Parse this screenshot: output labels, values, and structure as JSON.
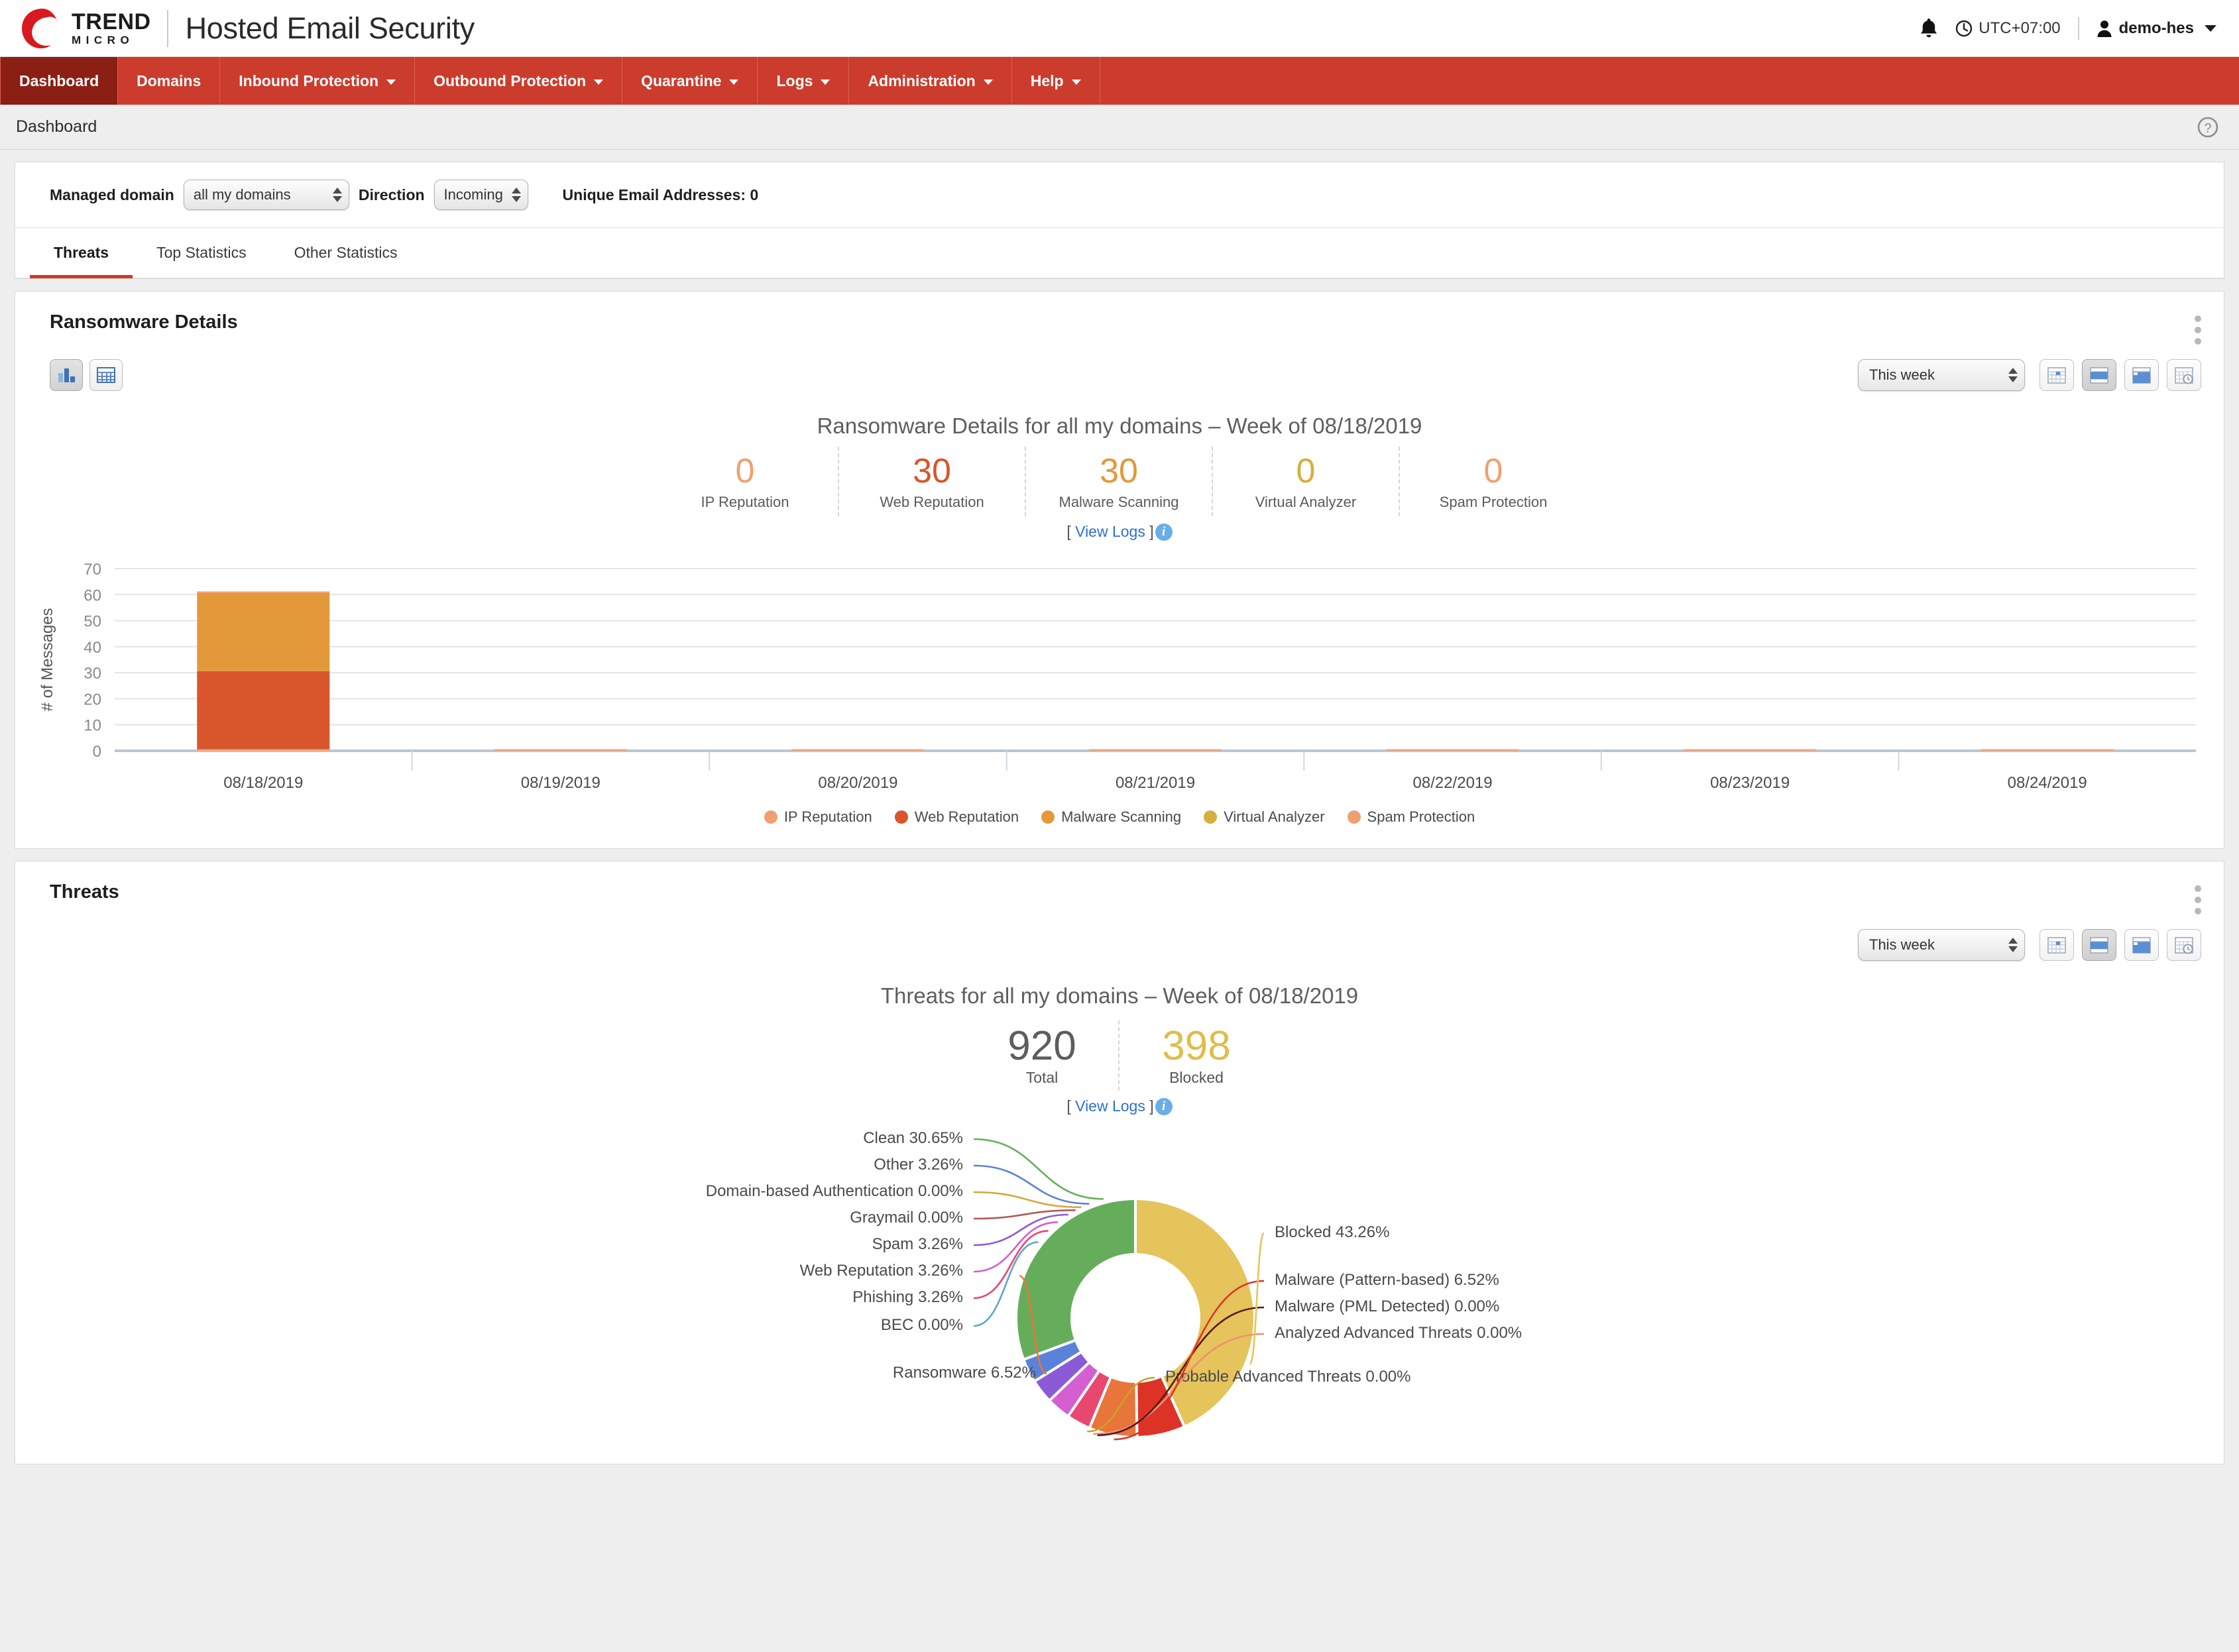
{
  "header": {
    "brand_line1": "TREND",
    "brand_line2": "MICRO",
    "app_title": "Hosted Email Security",
    "timezone": "UTC+07:00",
    "user": "demo-hes"
  },
  "nav": [
    {
      "label": "Dashboard",
      "has_caret": false,
      "active": true
    },
    {
      "label": "Domains",
      "has_caret": false,
      "active": false
    },
    {
      "label": "Inbound Protection",
      "has_caret": true,
      "active": false
    },
    {
      "label": "Outbound Protection",
      "has_caret": true,
      "active": false
    },
    {
      "label": "Quarantine",
      "has_caret": true,
      "active": false
    },
    {
      "label": "Logs",
      "has_caret": true,
      "active": false
    },
    {
      "label": "Administration",
      "has_caret": true,
      "active": false
    },
    {
      "label": "Help",
      "has_caret": true,
      "active": false
    }
  ],
  "breadcrumb": {
    "label": "Dashboard"
  },
  "filters": {
    "managed_domain_label": "Managed domain",
    "managed_domain_value": "all my domains",
    "direction_label": "Direction",
    "direction_value": "Incoming",
    "unique_emails": "Unique Email Addresses: 0"
  },
  "tabs": [
    {
      "label": "Threats",
      "active": true
    },
    {
      "label": "Top Statistics",
      "active": false
    },
    {
      "label": "Other Statistics",
      "active": false
    }
  ],
  "ransomware_panel": {
    "title": "Ransomware Details",
    "period_value": "This week",
    "view_chart_icon": "bar-chart-icon",
    "view_table_icon": "table-icon",
    "range_icons": [
      "calendar-day-icon",
      "calendar-week-icon",
      "calendar-month-icon",
      "calendar-history-icon"
    ],
    "view_logs_text": "[ View Logs ]",
    "view_logs_link": "View Logs"
  },
  "threats_panel": {
    "title": "Threats",
    "period_value": "This week",
    "view_logs_text": "[ View Logs ]",
    "view_logs_link": "View Logs",
    "total_label": "Total",
    "total_value": "920",
    "blocked_label": "Blocked",
    "blocked_value": "398"
  },
  "chart_data": [
    {
      "type": "bar",
      "title": "Ransomware Details for all my domains – Week of 08/18/2019",
      "xlabel": "",
      "ylabel": "# of Messages",
      "ylim": [
        0,
        70
      ],
      "yticks": [
        0,
        10,
        20,
        30,
        40,
        50,
        60,
        70
      ],
      "grid": true,
      "legend_position": "bottom",
      "stacked": true,
      "categories": [
        "08/18/2019",
        "08/19/2019",
        "08/20/2019",
        "08/21/2019",
        "08/22/2019",
        "08/23/2019",
        "08/24/2019"
      ],
      "series": [
        {
          "name": "IP Reputation",
          "color": "#f0a070",
          "values": [
            0.6,
            0.6,
            0.6,
            0.6,
            0.6,
            0.6,
            0.6
          ]
        },
        {
          "name": "Web Reputation",
          "color": "#d9552b",
          "values": [
            30,
            0,
            0,
            0,
            0,
            0,
            0
          ]
        },
        {
          "name": "Malware Scanning",
          "color": "#e3983a",
          "values": [
            30,
            0,
            0,
            0,
            0,
            0,
            0
          ]
        },
        {
          "name": "Virtual Analyzer",
          "color": "#d4b03c",
          "values": [
            0,
            0,
            0,
            0,
            0,
            0,
            0
          ]
        },
        {
          "name": "Spam Protection",
          "color": "#f0a070",
          "values": [
            0.6,
            0,
            0,
            0,
            0,
            0,
            0
          ]
        }
      ],
      "kpis": [
        {
          "label": "IP Reputation",
          "value": "0",
          "color": "#f0a070"
        },
        {
          "label": "Web Reputation",
          "value": "30",
          "color": "#d9552b"
        },
        {
          "label": "Malware Scanning",
          "value": "30",
          "color": "#e3983a"
        },
        {
          "label": "Virtual Analyzer",
          "value": "0",
          "color": "#d4b03c"
        },
        {
          "label": "Spam Protection",
          "value": "0",
          "color": "#f0a070"
        }
      ]
    },
    {
      "type": "pie",
      "title": "Threats for all my domains – Week of 08/18/2019",
      "donut": true,
      "start_angle_deg": 0,
      "labels": [
        "Blocked",
        "Malware (Pattern-based)",
        "Malware (PML Detected)",
        "Analyzed Advanced Threats",
        "Probable Advanced Threats",
        "Ransomware",
        "BEC",
        "Phishing",
        "Web Reputation",
        "Spam",
        "Graymail",
        "Domain-based Authentication",
        "Other",
        "Clean"
      ],
      "values": [
        43.26,
        6.52,
        0.0,
        0.0,
        0.0,
        6.52,
        0.0,
        3.26,
        3.26,
        3.26,
        0.0,
        0.0,
        3.26,
        30.65
      ],
      "unit": "%",
      "colors": [
        "#e6c45c",
        "#dd3327",
        "#5c1717",
        "#ef8f72",
        "#c9a227",
        "#e8753a",
        "#5aa8c8",
        "#e8476f",
        "#d35fd3",
        "#8b5ad6",
        "#b05a5a",
        "#d9a53a",
        "#5b82d9",
        "#66ad5b"
      ],
      "data_labels": [
        "Clean 30.65%",
        "Other 3.26%",
        "Domain-based Authentication 0.00%",
        "Graymail 0.00%",
        "Spam 3.26%",
        "Web Reputation 3.26%",
        "Phishing 3.26%",
        "BEC 0.00%",
        "Ransomware 6.52%",
        "Probable Advanced Threats 0.00%",
        "Analyzed Advanced Threats 0.00%",
        "Malware (PML Detected) 0.00%",
        "Malware (Pattern-based) 6.52%",
        "Blocked 43.26%"
      ]
    }
  ]
}
